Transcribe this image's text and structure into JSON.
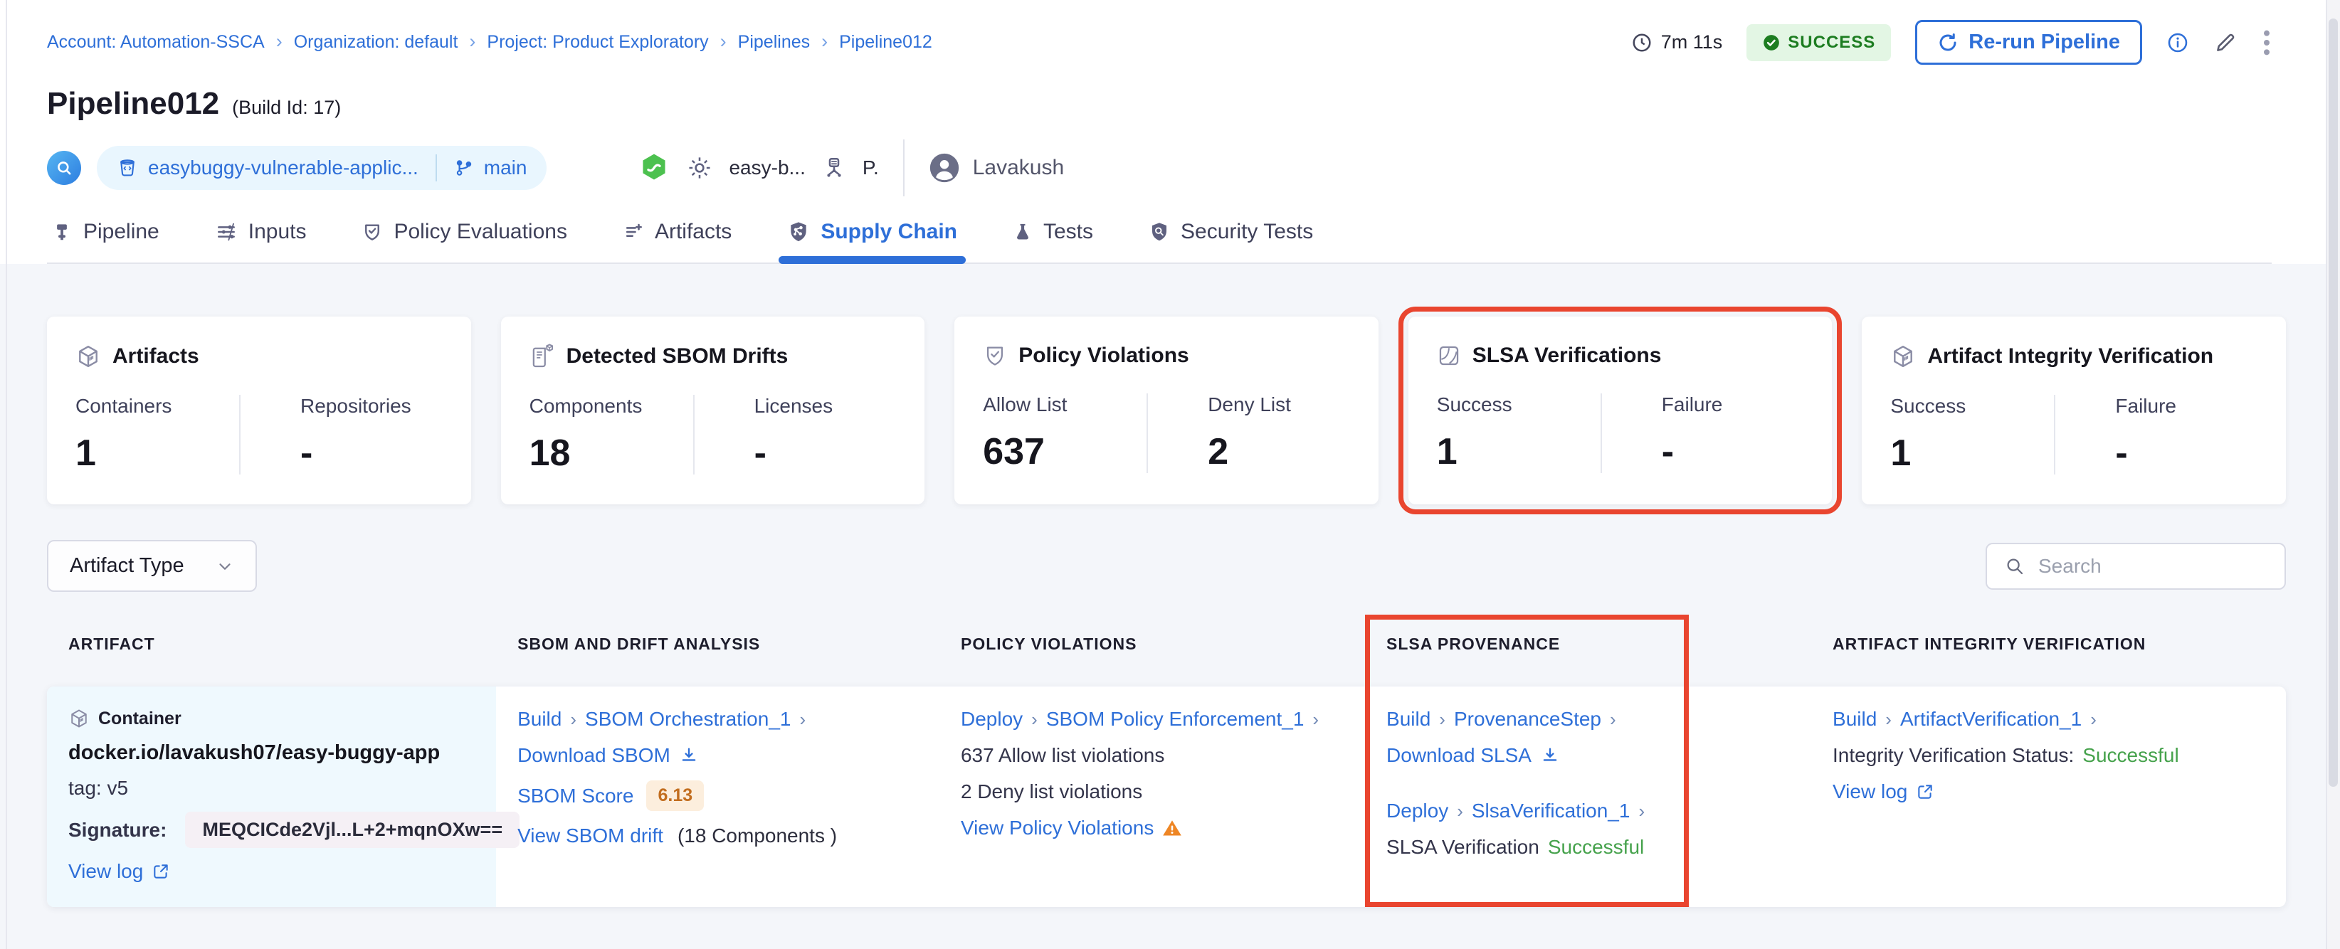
{
  "ui": {
    "sep": "›"
  },
  "breadcrumb": [
    "Account: Automation-SSCA",
    "Organization: default",
    "Project: Product Exploratory",
    "Pipelines",
    "Pipeline012"
  ],
  "header": {
    "title": "Pipeline012",
    "build_id": "(Build Id: 17)",
    "duration": "7m 11s",
    "status": "SUCCESS",
    "rerun": "Re-run Pipeline",
    "repo": "easybuggy-vulnerable-applic...",
    "branch": "main",
    "trigger_pipeline": "easy-b...",
    "trigger_user": "P.",
    "user": "Lavakush"
  },
  "tabs": [
    {
      "label": "Pipeline"
    },
    {
      "label": "Inputs"
    },
    {
      "label": "Policy Evaluations"
    },
    {
      "label": "Artifacts"
    },
    {
      "label": "Supply Chain"
    },
    {
      "label": "Tests"
    },
    {
      "label": "Security Tests"
    }
  ],
  "cards": [
    {
      "title": "Artifacts",
      "metrics": [
        {
          "label": "Containers",
          "value": "1"
        },
        {
          "label": "Repositories",
          "value": "-"
        }
      ]
    },
    {
      "title": "Detected SBOM Drifts",
      "metrics": [
        {
          "label": "Components",
          "value": "18"
        },
        {
          "label": "Licenses",
          "value": "-"
        }
      ]
    },
    {
      "title": "Policy Violations",
      "metrics": [
        {
          "label": "Allow List",
          "value": "637"
        },
        {
          "label": "Deny List",
          "value": "2"
        }
      ]
    },
    {
      "title": "SLSA Verifications",
      "metrics": [
        {
          "label": "Success",
          "value": "1"
        },
        {
          "label": "Failure",
          "value": "-"
        }
      ]
    },
    {
      "title": "Artifact Integrity Verification",
      "metrics": [
        {
          "label": "Success",
          "value": "1"
        },
        {
          "label": "Failure",
          "value": "-"
        }
      ]
    }
  ],
  "filters": {
    "artifact_type": "Artifact Type",
    "search_placeholder": "Search"
  },
  "table": {
    "headers": [
      "ARTIFACT",
      "SBOM AND DRIFT ANALYSIS",
      "POLICY VIOLATIONS",
      "SLSA PROVENANCE",
      "ARTIFACT INTEGRITY VERIFICATION"
    ],
    "row": {
      "artifact": {
        "type": "Container",
        "image": "docker.io/lavakush07/easy-buggy-app",
        "tag": "tag: v5",
        "signature_label": "Signature:",
        "signature": "MEQCICde2Vjl...L+2+mqnOXw==",
        "view_log": "View log"
      },
      "sbom": {
        "stage": "Build",
        "step": "SBOM Orchestration_1",
        "download": "Download SBOM",
        "score_label": "SBOM Score",
        "score": "6.13",
        "drift_link": "View SBOM drift",
        "drift_info": "(18 Components )"
      },
      "policy": {
        "stage": "Deploy",
        "step": "SBOM Policy Enforcement_1",
        "allow": "637 Allow list violations",
        "deny": "2 Deny list violations",
        "view": "View Policy Violations"
      },
      "slsa": {
        "stage1": "Build",
        "step1": "ProvenanceStep",
        "download": "Download SLSA",
        "stage2": "Deploy",
        "step2": "SlsaVerification_1",
        "status_label": "SLSA Verification",
        "status": "Successful"
      },
      "integrity": {
        "stage": "Build",
        "step": "ArtifactVerification_1",
        "status_label": "Integrity Verification Status:",
        "status": "Successful",
        "view_log": "View log"
      }
    }
  },
  "colors": {
    "accent_blue": "#2e6fd8",
    "annotation_red": "#e9452f",
    "success_text_green": "#46a24c",
    "badge_green": "#1d7d21",
    "warning_orange": "#ee8625",
    "score_orange": "#c26d1e",
    "artifact_cell_bg": "#eff9fe"
  }
}
